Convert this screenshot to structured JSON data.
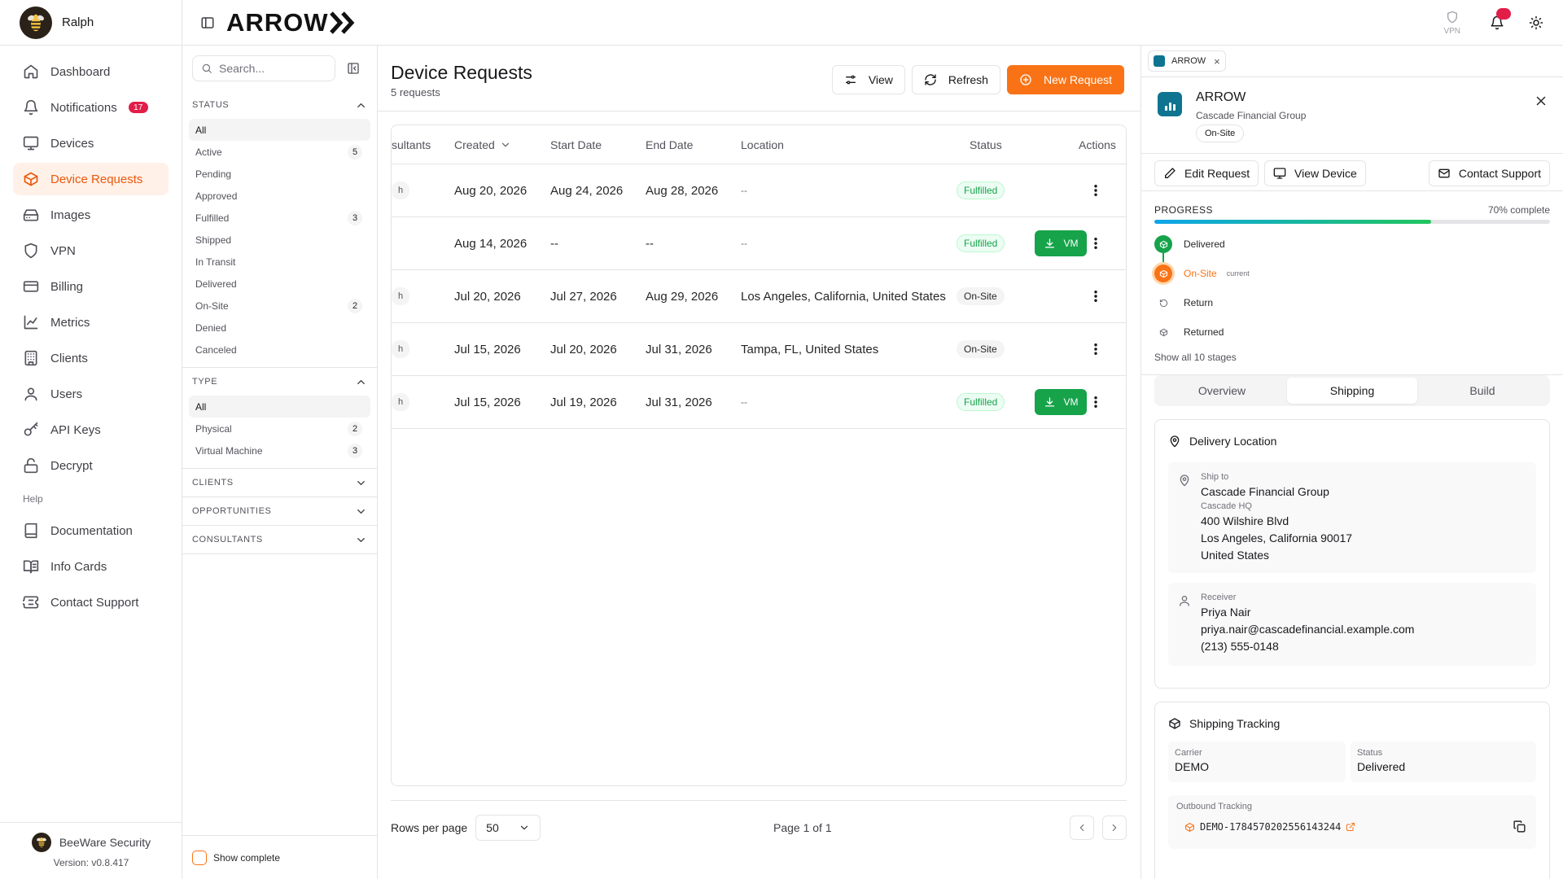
{
  "user": {
    "name": "Ralph"
  },
  "nav": {
    "items": [
      {
        "id": "dashboard",
        "label": "Dashboard",
        "icon": "home-icon"
      },
      {
        "id": "notifications",
        "label": "Notifications",
        "icon": "bell-icon",
        "badge": "17"
      },
      {
        "id": "devices",
        "label": "Devices",
        "icon": "monitor-icon"
      },
      {
        "id": "device-requests",
        "label": "Device Requests",
        "icon": "package-icon",
        "active": true
      },
      {
        "id": "images",
        "label": "Images",
        "icon": "hard-drive-icon"
      },
      {
        "id": "vpn",
        "label": "VPN",
        "icon": "shield-icon"
      },
      {
        "id": "billing",
        "label": "Billing",
        "icon": "credit-card-icon"
      },
      {
        "id": "metrics",
        "label": "Metrics",
        "icon": "line-chart-icon"
      },
      {
        "id": "clients",
        "label": "Clients",
        "icon": "building-icon"
      },
      {
        "id": "users",
        "label": "Users",
        "icon": "user-icon"
      },
      {
        "id": "api-keys",
        "label": "API Keys",
        "icon": "key-icon"
      },
      {
        "id": "decrypt",
        "label": "Decrypt",
        "icon": "lock-open-icon"
      }
    ],
    "help_label": "Help",
    "help_items": [
      {
        "id": "documentation",
        "label": "Documentation",
        "icon": "book-icon"
      },
      {
        "id": "info-cards",
        "label": "Info Cards",
        "icon": "book-open-icon"
      },
      {
        "id": "contact-support",
        "label": "Contact Support",
        "icon": "ticket-icon"
      }
    ],
    "org_name": "BeeWare Security",
    "version": "Version: v0.8.417"
  },
  "topbar": {
    "logo": "ARROW",
    "vpn_label": "VPN"
  },
  "filters": {
    "search_placeholder": "Search...",
    "status": {
      "title": "STATUS",
      "options": [
        {
          "label": "All",
          "selected": true
        },
        {
          "label": "Active",
          "count": "5"
        },
        {
          "label": "Pending"
        },
        {
          "label": "Approved"
        },
        {
          "label": "Fulfilled",
          "count": "3"
        },
        {
          "label": "Shipped"
        },
        {
          "label": "In Transit"
        },
        {
          "label": "Delivered"
        },
        {
          "label": "On-Site",
          "count": "2"
        },
        {
          "label": "Denied"
        },
        {
          "label": "Canceled"
        }
      ]
    },
    "type": {
      "title": "TYPE",
      "options": [
        {
          "label": "All",
          "selected": true
        },
        {
          "label": "Physical",
          "count": "2"
        },
        {
          "label": "Virtual Machine",
          "count": "3"
        }
      ]
    },
    "collapsed": [
      "CLIENTS",
      "OPPORTUNITIES",
      "CONSULTANTS"
    ],
    "show_complete": "Show complete"
  },
  "main": {
    "title": "Device Requests",
    "subtitle": "5 requests",
    "view_label": "View",
    "refresh_label": "Refresh",
    "new_label": "New Request",
    "columns": [
      "sultants",
      "Created",
      "Start Date",
      "End Date",
      "Location",
      "Status",
      "Actions"
    ],
    "rows": [
      {
        "consultant": "h",
        "created": "Aug 20, 2026",
        "start": "Aug 24, 2026",
        "end": "Aug 28, 2026",
        "location": "--",
        "status": "Fulfilled",
        "vm": false
      },
      {
        "consultant": "",
        "created": "Aug 14, 2026",
        "start": "--",
        "end": "--",
        "location": "--",
        "status": "Fulfilled",
        "vm": true
      },
      {
        "consultant": "h",
        "created": "Jul 20, 2026",
        "start": "Jul 27, 2026",
        "end": "Aug 29, 2026",
        "location": "Los Angeles, California, United States",
        "status": "On-Site",
        "vm": false
      },
      {
        "consultant": "h",
        "created": "Jul 15, 2026",
        "start": "Jul 20, 2026",
        "end": "Jul 31, 2026",
        "location": "Tampa, FL, United States",
        "status": "On-Site",
        "vm": false
      },
      {
        "consultant": "h",
        "created": "Jul 15, 2026",
        "start": "Jul 19, 2026",
        "end": "Jul 31, 2026",
        "location": "--",
        "status": "Fulfilled",
        "vm": true
      }
    ],
    "vm_label": "VM",
    "rows_per_page_label": "Rows per page",
    "rows_per_page": "50",
    "page_info": "Page 1 of 1"
  },
  "detail": {
    "tab_label": "ARROW",
    "title": "ARROW",
    "client": "Cascade Financial Group",
    "status_chip": "On-Site",
    "edit_label": "Edit Request",
    "view_device_label": "View Device",
    "contact_label": "Contact Support",
    "progress_label": "PROGRESS",
    "progress_pct_text": "70% complete",
    "progress_value": 0.7,
    "stages": [
      {
        "label": "Delivered",
        "state": "done"
      },
      {
        "label": "On-Site",
        "state": "current",
        "tag": "current"
      },
      {
        "label": "Return",
        "state": "pending"
      },
      {
        "label": "Returned",
        "state": "pending"
      }
    ],
    "show_all": "Show all 10 stages",
    "tabs": [
      "Overview",
      "Shipping",
      "Build"
    ],
    "active_tab": "Shipping",
    "delivery": {
      "title": "Delivery Location",
      "ship_to_label": "Ship to",
      "ship_to_name": "Cascade Financial Group",
      "site": "Cascade HQ",
      "address1": "400 Wilshire Blvd",
      "address2": "Los Angeles, California 90017",
      "country": "United States",
      "receiver_label": "Receiver",
      "receiver_name": "Priya Nair",
      "receiver_email": "priya.nair@cascadefinancial.example.com",
      "receiver_phone": "(213) 555-0148"
    },
    "tracking": {
      "title": "Shipping Tracking",
      "carrier_label": "Carrier",
      "carrier": "DEMO",
      "status_label": "Status",
      "status": "Delivered",
      "outbound_label": "Outbound Tracking",
      "outbound_number": "DEMO-1784570202556143244"
    }
  },
  "colors": {
    "accent": "#f97316",
    "success": "#16a34a",
    "danger": "#e11d48",
    "brand_tile": "#0e7490"
  }
}
